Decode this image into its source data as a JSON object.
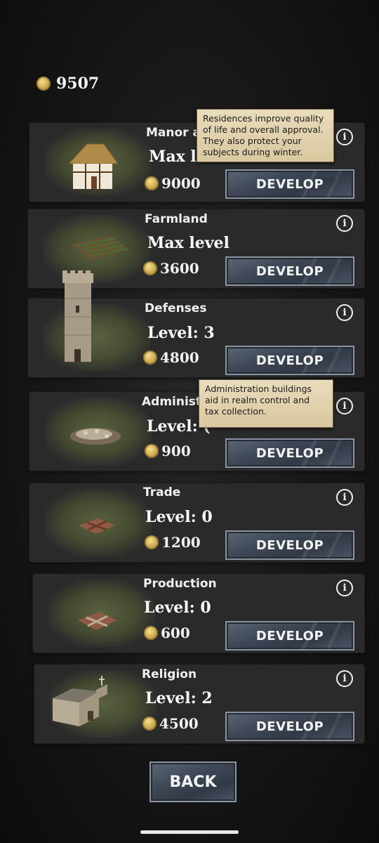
{
  "gold": {
    "value": "9507",
    "icon": "coin-icon"
  },
  "buildings": [
    {
      "title": "Manor a",
      "level": "Max le",
      "cost": "9000",
      "button": "DEVELOP",
      "icon": "thatched-house-icon"
    },
    {
      "title": "Farmland",
      "level": "Max level",
      "cost": "3600",
      "button": "DEVELOP",
      "icon": "field-icon"
    },
    {
      "title": "Defenses",
      "level": "Level: 3",
      "cost": "4800",
      "button": "DEVELOP",
      "icon": "stone-tower-icon"
    },
    {
      "title": "Administ",
      "level": "Level: (",
      "cost": "900",
      "button": "DEVELOP",
      "icon": "rubble-icon"
    },
    {
      "title": "Trade",
      "level": "Level: 0",
      "cost": "1200",
      "button": "DEVELOP",
      "icon": "trade-plot-icon"
    },
    {
      "title": "Production",
      "level": "Level: 0",
      "cost": "600",
      "button": "DEVELOP",
      "icon": "production-plot-icon"
    },
    {
      "title": "Religion",
      "level": "Level: 2",
      "cost": "4500",
      "button": "DEVELOP",
      "icon": "chapel-icon"
    }
  ],
  "tooltips": {
    "residences": [
      "Residences improve quality",
      "of life and overall approval.",
      "They also protect your",
      "subjects during winter."
    ],
    "administration": [
      "Administration buildings",
      "aid in realm control and",
      "tax collection."
    ]
  },
  "back_label": "BACK",
  "info_glyph": "i"
}
